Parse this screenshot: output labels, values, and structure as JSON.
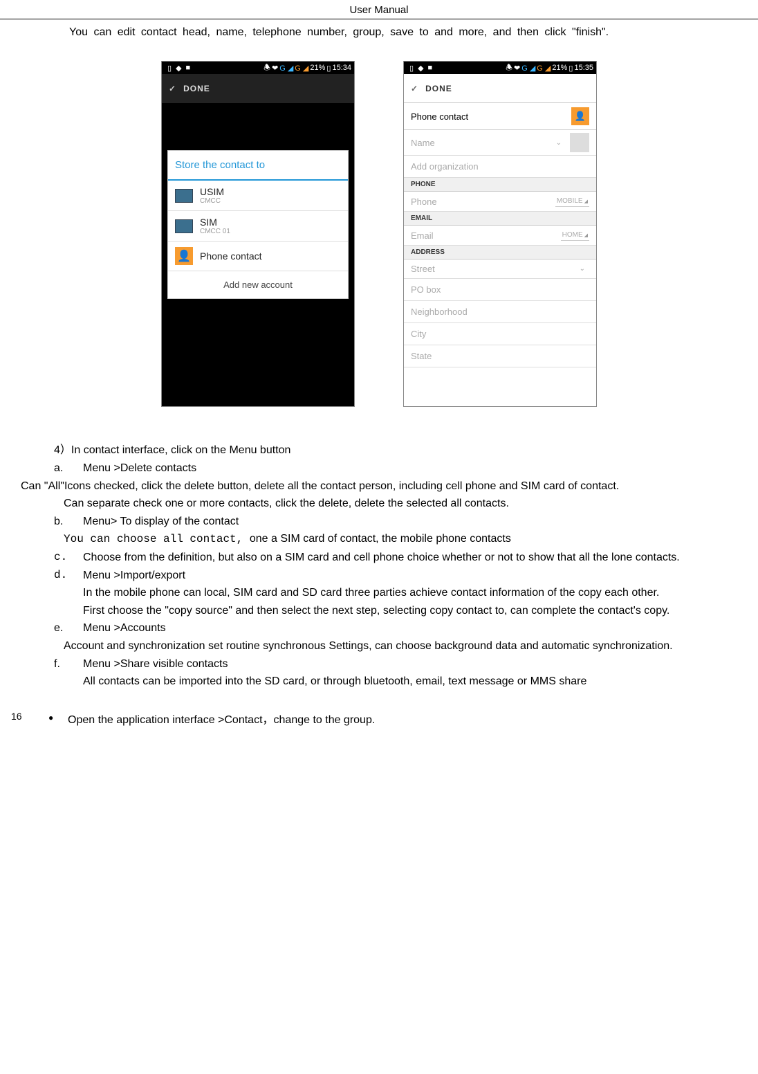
{
  "header": "User    Manual",
  "intro": "You can edit contact head, name, telephone number, group, save to and more, and then click \"finish\".",
  "screenshot_left": {
    "status_time": "15:34",
    "status_batt": "21%",
    "done": "DONE",
    "dialog_title": "Store the contact to",
    "opt1_title": "USIM",
    "opt1_sub": "CMCC",
    "opt2_title": "SIM",
    "opt2_sub": "CMCC 01",
    "opt3_title": "Phone contact",
    "footer": "Add new account"
  },
  "screenshot_right": {
    "status_time": "15:35",
    "status_batt": "21%",
    "done": "DONE",
    "phone_contact": "Phone contact",
    "name": "Name",
    "add_org": "Add organization",
    "phone_hdr": "PHONE",
    "phone_ph": "Phone",
    "phone_type": "MOBILE",
    "email_hdr": "EMAIL",
    "email_ph": "Email",
    "email_type": "HOME",
    "address_hdr": "ADDRESS",
    "street": "Street",
    "pobox": "PO box",
    "neighborhood": "Neighborhood",
    "city": "City",
    "state": "State"
  },
  "item4": "4）In contact   interface, click on the Menu button",
  "a_marker": "a.",
  "a_title": "Menu >Delete contacts",
  "a_p1": "Can \"All\"Icons checked, click the delete button, delete all the contact person, including cell phone and SIM card of contact.",
  "a_p2": "Can separate check one or more contacts, click the delete, delete the selected all contacts.",
  "b_marker": "b.",
  "b_title_prefix": "Menu> ",
  "b_title_rest": "To display of the contact",
  "b_p1_prefix": "You can choose all contact, ",
  "b_p1_rest": "one a SIM card of contact, the mobile phone contacts",
  "c_marker": "c.",
  "c_text": "Choose from the definition, but also on a SIM card and cell phone choice whether or not to show that all the lone contacts.",
  "d_marker": "d.",
  "d_title": "Menu >Import/export",
  "d_p1": "In the mobile phone can local, SIM card and SD card three parties achieve contact information of the copy each other.",
  "d_p2": "First choose the \"copy source\" and then select the next step, selecting copy contact to, can complete the contact's copy.",
  "e_marker": "e.",
  "e_title": "Menu >Accounts",
  "e_p1": "Account and synchronization set routine synchronous Settings, can choose background data and automatic synchronization.",
  "f_marker": "f.",
  "f_title": "Menu >Share visible contacts",
  "f_p1": "All contacts can be imported into the SD card, or through bluetooth, email, text message or MMS share",
  "bullet": "Open the   application interface    >Contact，change to the group.",
  "pgnum": "16"
}
